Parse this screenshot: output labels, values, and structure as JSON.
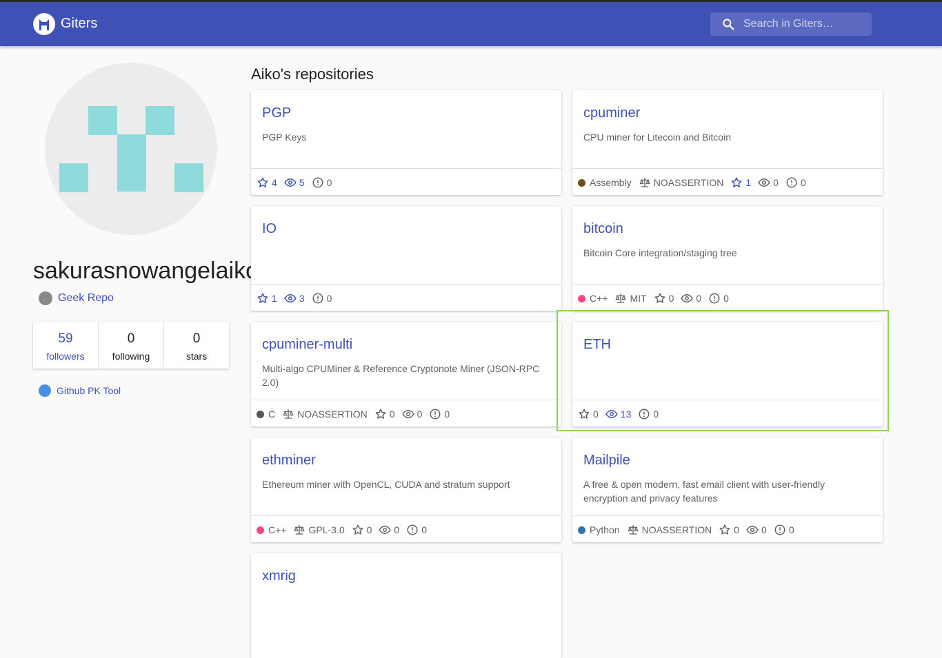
{
  "app": {
    "title": "Giters",
    "search_placeholder": "Search in Giters…"
  },
  "profile": {
    "username": "sakurasnowangelaiko",
    "geek_repo_label": "Geek Repo",
    "stats": [
      {
        "value": "59",
        "label": "followers"
      },
      {
        "value": "0",
        "label": "following"
      },
      {
        "value": "0",
        "label": "stars"
      }
    ],
    "pk_tool_label": "Github PK Tool"
  },
  "repos_title": "Aiko's repositories",
  "colors": {
    "accent": "#3f51b5",
    "avatar": "#8fdbdc",
    "highlight": "#8bd64a"
  },
  "repos": [
    {
      "name": "PGP",
      "description": "PGP Keys",
      "stars": "4",
      "watchers": "5",
      "issues": "0"
    },
    {
      "name": "cpuminer",
      "description": "CPU miner for Litecoin and Bitcoin",
      "language": "Assembly",
      "language_color": "#6e4c13",
      "license": "NOASSERTION",
      "stars": "1",
      "watchers": "0",
      "issues": "0"
    },
    {
      "name": "IO",
      "description": "",
      "stars": "1",
      "watchers": "3",
      "issues": "0"
    },
    {
      "name": "bitcoin",
      "description": "Bitcoin Core integration/staging tree",
      "language": "C++",
      "language_color": "#f34b7d",
      "license": "MIT",
      "stars": "0",
      "watchers": "0",
      "issues": "0"
    },
    {
      "name": "cpuminer-multi",
      "description": "Multi-algo CPUMiner & Reference Cryptonote Miner (JSON-RPC 2.0)",
      "language": "C",
      "language_color": "#555555",
      "license": "NOASSERTION",
      "stars": "0",
      "watchers": "0",
      "issues": "0"
    },
    {
      "name": "ETH",
      "description": "",
      "stars": "0",
      "watchers": "13",
      "issues": "0"
    },
    {
      "name": "ethminer",
      "description": "Ethereum miner with OpenCL, CUDA and stratum support",
      "language": "C++",
      "language_color": "#f34b7d",
      "license": "GPL-3.0",
      "stars": "0",
      "watchers": "0",
      "issues": "0"
    },
    {
      "name": "Mailpile",
      "description": "A free & open modern, fast email client with user-friendly encryption and privacy features",
      "language": "Python",
      "language_color": "#3572a5",
      "license": "NOASSERTION",
      "stars": "0",
      "watchers": "0",
      "issues": "0"
    },
    {
      "name": "xmrig"
    }
  ]
}
